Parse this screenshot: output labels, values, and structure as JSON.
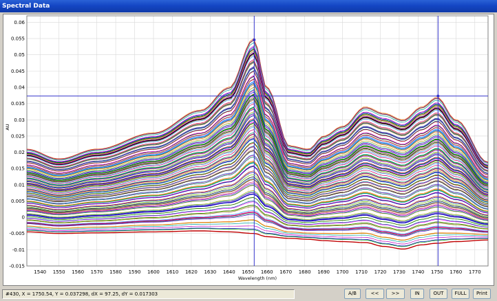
{
  "window": {
    "title": "Spectral Data"
  },
  "status": {
    "readout": "#430,  X = 1750.54,  Y = 0.037298,  dX = 97.25,  dY = 0.017303"
  },
  "buttons": {
    "ab": "A/B",
    "prev": "<<",
    "next": ">>",
    "zoom_in": "IN",
    "zoom_out": "OUT",
    "full": "FULL",
    "print": "Print"
  },
  "colors": {
    "cursor": "#3333cc",
    "grid": "#d8d8d8"
  },
  "chart_data": {
    "type": "line",
    "xlabel": "Wavelength (nm)",
    "ylabel": "AU",
    "xlim": [
      1533,
      1777
    ],
    "ylim": [
      -0.015,
      0.062
    ],
    "x_ticks": [
      1540,
      1550,
      1560,
      1570,
      1580,
      1590,
      1600,
      1610,
      1620,
      1630,
      1640,
      1650,
      1660,
      1670,
      1680,
      1690,
      1700,
      1710,
      1720,
      1730,
      1740,
      1750,
      1760,
      1770
    ],
    "y_ticks": [
      "-0.015",
      "-0.01",
      "-0.005",
      "0",
      "0.005",
      "0.01",
      "0.015",
      "0.02",
      "0.025",
      "0.03",
      "0.035",
      "0.04",
      "0.045",
      "0.05",
      "0.055",
      "0.06"
    ],
    "y_tick_values": [
      -0.015,
      -0.01,
      -0.005,
      0,
      0.005,
      0.01,
      0.015,
      0.02,
      0.025,
      0.03,
      0.035,
      0.04,
      0.045,
      0.05,
      0.055,
      0.06
    ],
    "grid": true,
    "series_count": 120,
    "envelope": {
      "x": [
        1533,
        1550,
        1570,
        1600,
        1625,
        1640,
        1653,
        1660,
        1672,
        1682,
        1690,
        1700,
        1712,
        1722,
        1732,
        1742,
        1750,
        1760,
        1777
      ],
      "top": [
        0.021,
        0.018,
        0.021,
        0.026,
        0.033,
        0.04,
        0.055,
        0.04,
        0.022,
        0.021,
        0.025,
        0.028,
        0.034,
        0.032,
        0.03,
        0.034,
        0.037,
        0.03,
        0.017
      ],
      "bottom": [
        -0.0045,
        -0.005,
        -0.0048,
        -0.0045,
        -0.0042,
        -0.0045,
        -0.005,
        -0.006,
        -0.0065,
        -0.0068,
        -0.0072,
        -0.0075,
        -0.0078,
        -0.009,
        -0.0098,
        -0.0085,
        -0.008,
        -0.0075,
        -0.007
      ]
    },
    "cursor_a": {
      "x": 1653.29,
      "y": 0.054601
    },
    "cursor_b": {
      "x": 1750.54,
      "y": 0.037298
    }
  }
}
